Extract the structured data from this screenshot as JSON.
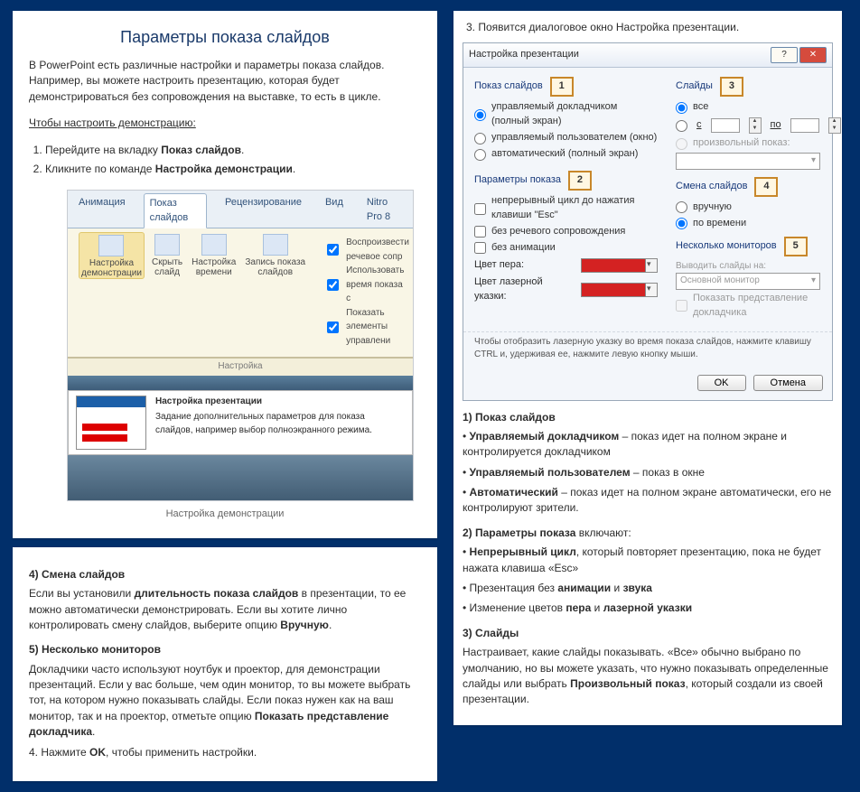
{
  "left_top": {
    "title": "Параметры показа слайдов",
    "intro": "В PowerPoint есть различные настройки и параметры показа слайдов. Например, вы можете настроить презентацию, которая будет демонстрироваться без сопровождения на выставке, то есть в цикле.",
    "howto": "Чтобы настроить демонстрацию:",
    "step1_pre": "Перейдите на вкладку ",
    "step1_b": "Показ слайдов",
    "step2_pre": "Кликните по команде ",
    "step2_b": "Настройка демонстрации",
    "ribbon": {
      "tab1": "Анимация",
      "tab_active": "Показ слайдов",
      "tab3": "Рецензирование",
      "tab4": "Вид",
      "tab5": "Nitro Pro 8",
      "btn1": "Настройка\nдемонстрации",
      "btn2": "Скрыть\nслайд",
      "btn3": "Настройка\nвремени",
      "btn4": "Запись показа\nслайдов",
      "chk1": "Воспроизвести речевое сопр",
      "chk2": "Использовать время показа с",
      "chk3": "Показать элементы управлени",
      "group": "Настройка"
    },
    "tip": {
      "title": "Настройка презентации",
      "body": "Задание дополнительных параметров для показа слайдов, например выбор полноэкранного режима."
    },
    "caption": "Настройка демонстрации"
  },
  "left_bottom": {
    "h4": "4) Смена слайдов",
    "p4a": "Если вы установили ",
    "p4b": "длительность показа слайдов",
    "p4c": " в презентации, то ее можно автоматически демонстрировать. Если вы хотите лично контролировать смену слайдов, выберите опцию ",
    "p4d": "Вручную",
    "h5": "5) Несколько мониторов",
    "p5a": "Докладчики часто используют ноутбук и проектор, для демонстрации презентаций. Если у вас больше, чем один монитор, то вы можете выбрать тот, на котором нужно показывать слайды. Если показ нужен как на ваш монитор, так и на проектор, отметьте опцию ",
    "p5b": "Показать представление докладчика",
    "s4": "4. Нажмите ",
    "s4b": "OK",
    "s4c": ", чтобы применить настройки."
  },
  "right_top": {
    "lead": "3.  Появится диалоговое окно Настройка презентации.",
    "dlg_title": "Настройка презентации",
    "g_show": "Показ слайдов",
    "tag1": "1",
    "r1": "управляемый докладчиком (полный экран)",
    "r2": "управляемый пользователем (окно)",
    "r3": "автоматический (полный экран)",
    "g_params": "Параметры показа",
    "tag2": "2",
    "c1": "непрерывный цикл до нажатия клавиши \"Esc\"",
    "c2": "без речевого сопровождения",
    "c3": "без анимации",
    "penlabel": "Цвет пера:",
    "laserlabel": "Цвет лазерной указки:",
    "g_slides": "Слайды",
    "tag3": "3",
    "s_all": "все",
    "s_from": "с",
    "s_to": "по",
    "s_custom": "произвольный показ:",
    "g_advance": "Смена слайдов",
    "tag4": "4",
    "a_manual": "вручную",
    "a_time": "по времени",
    "g_monitors": "Несколько мониторов",
    "tag5": "5",
    "mlabel": "Выводить слайды на:",
    "mval": "Основной монитор",
    "mchk": "Показать представление докладчика",
    "note": "Чтобы отобразить лазерную указку во время показа слайдов, нажмите клавишу CTRL и, удерживая ее, нажмите левую кнопку мыши.",
    "ok": "OK",
    "cancel": "Отмена"
  },
  "right_bottom": {
    "h1": "1) Показ слайдов",
    "b1a": "Управляемый докладчиком",
    "b1b": " – показ идет на полном экране и контролируется докладчиком",
    "b2a": "Управляемый пользователем",
    "b2b": " – показ в окне",
    "b3a": "Автоматический",
    "b3b": " – показ идет на полном экране автоматически, его не контролируют зрители.",
    "h2p": "2) Параметры показа",
    "h2s": " включают:",
    "p1a": "Непрерывный цикл",
    "p1b": ", который повторяет презентацию, пока не будет нажата клавиша «Esc»",
    "p2a": "Презентация без ",
    "p2b": "анимации",
    "p2c": " и ",
    "p2d": "звука",
    "p3a": "Изменение цветов ",
    "p3b": "пера",
    "p3c": " и ",
    "p3d": "лазерной указки",
    "h3": "3) Слайды",
    "p4a": "Настраивает, какие слайды показывать. «Все» обычно выбрано по умолчанию, но вы можете указать, что нужно показывать определенные слайды или выбрать ",
    "p4b": "Произвольный показ",
    "p4c": ", который создали из своей презентации."
  }
}
